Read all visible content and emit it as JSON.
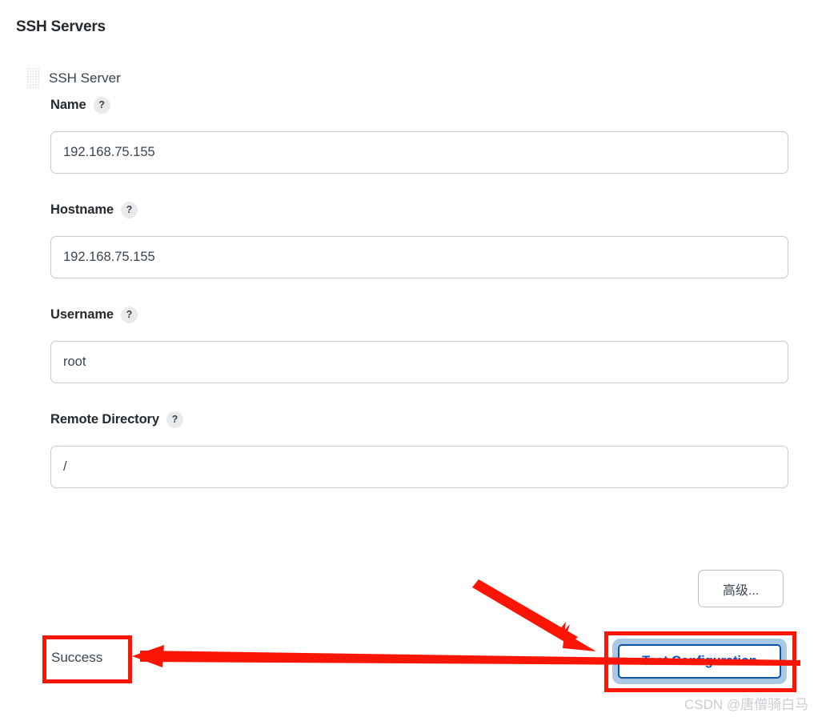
{
  "page": {
    "title": "SSH Servers"
  },
  "server": {
    "drag_handle_icon": "drag-grip-icon",
    "label": "SSH Server"
  },
  "fields": [
    {
      "label": "Name",
      "help_icon": "question-mark-icon",
      "value": "192.168.75.155",
      "placeholder": ""
    },
    {
      "label": "Hostname",
      "help_icon": "question-mark-icon",
      "value": "192.168.75.155",
      "placeholder": ""
    },
    {
      "label": "Username",
      "help_icon": "question-mark-icon",
      "value": "root",
      "placeholder": ""
    },
    {
      "label": "Remote Directory",
      "help_icon": "question-mark-icon",
      "value": "/",
      "placeholder": ""
    }
  ],
  "buttons": {
    "advanced_label": "高级...",
    "test_label": "Test Configuration"
  },
  "status": {
    "text": "Success"
  },
  "watermark": {
    "text": "CSDN @唐僧骑白马"
  },
  "colors": {
    "annotation_red": "#fb1505",
    "button_blue": "#1250c8",
    "button_border_blue": "#0b55a8",
    "focus_ring_blue": "#a8c8e4",
    "input_border": "#c3ccd4",
    "text_dark": "#24292e"
  }
}
